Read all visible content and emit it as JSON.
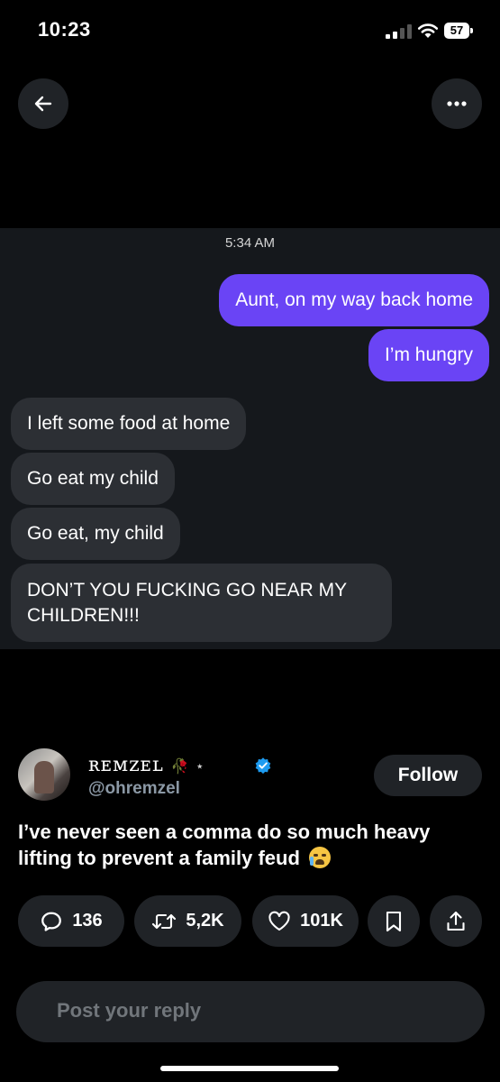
{
  "status_bar": {
    "time": "10:23",
    "battery": "57"
  },
  "chat": {
    "timestamp": "5:34 AM",
    "messages": [
      {
        "from": "me",
        "text": "Aunt, on my way back home"
      },
      {
        "from": "me",
        "text": "I’m hungry"
      },
      {
        "from": "them",
        "text": "I left some food at home"
      },
      {
        "from": "them",
        "text": "Go eat my child"
      },
      {
        "from": "them",
        "text": "Go eat, my child"
      },
      {
        "from": "them",
        "text": "DON’T YOU FUCKING GO NEAR MY CHILDREN!!!"
      }
    ]
  },
  "author": {
    "display_name": "ʀᴇᴍᴢᴇʟ",
    "name_decor": "🥀 ⋆",
    "handle": "@ohremzel",
    "follow_label": "Follow"
  },
  "tweet": {
    "text": "I’ve never seen a comma do so much heavy lifting to prevent a family feud",
    "emoji": "loudly-crying-face"
  },
  "actions": {
    "replies": "136",
    "reposts": "5,2K",
    "likes": "101K"
  },
  "reply": {
    "placeholder": "Post your reply"
  },
  "colors": {
    "accent": "#6a44f5",
    "verified": "#1d9bf0"
  }
}
